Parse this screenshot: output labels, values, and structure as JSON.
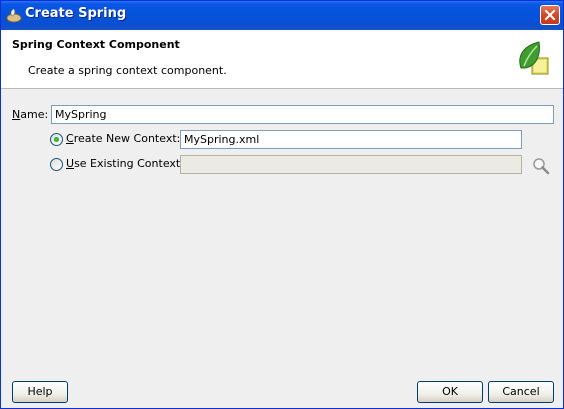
{
  "window": {
    "title": "Create Spring"
  },
  "header": {
    "title": "Spring Context Component",
    "description": "Create a spring context component."
  },
  "form": {
    "name_label_u": "N",
    "name_label_rest": "ame:",
    "name_value": "MySpring",
    "create_new": {
      "label_u": "C",
      "label_rest": "reate New Context:",
      "value": "MySpring.xml",
      "selected": true
    },
    "use_existing": {
      "label_u": "U",
      "label_rest": "se Existing Context:",
      "value": "",
      "selected": false
    }
  },
  "buttons": {
    "help": "Help",
    "ok": "OK",
    "cancel": "Cancel"
  },
  "icons": {
    "app": "spring-app-icon",
    "close": "close-icon",
    "header": "spring-leaf-icon",
    "browse": "search-icon"
  },
  "colors": {
    "titlebar": "#0453d9",
    "close": "#d04a2a",
    "radio_dot": "#21a121"
  }
}
